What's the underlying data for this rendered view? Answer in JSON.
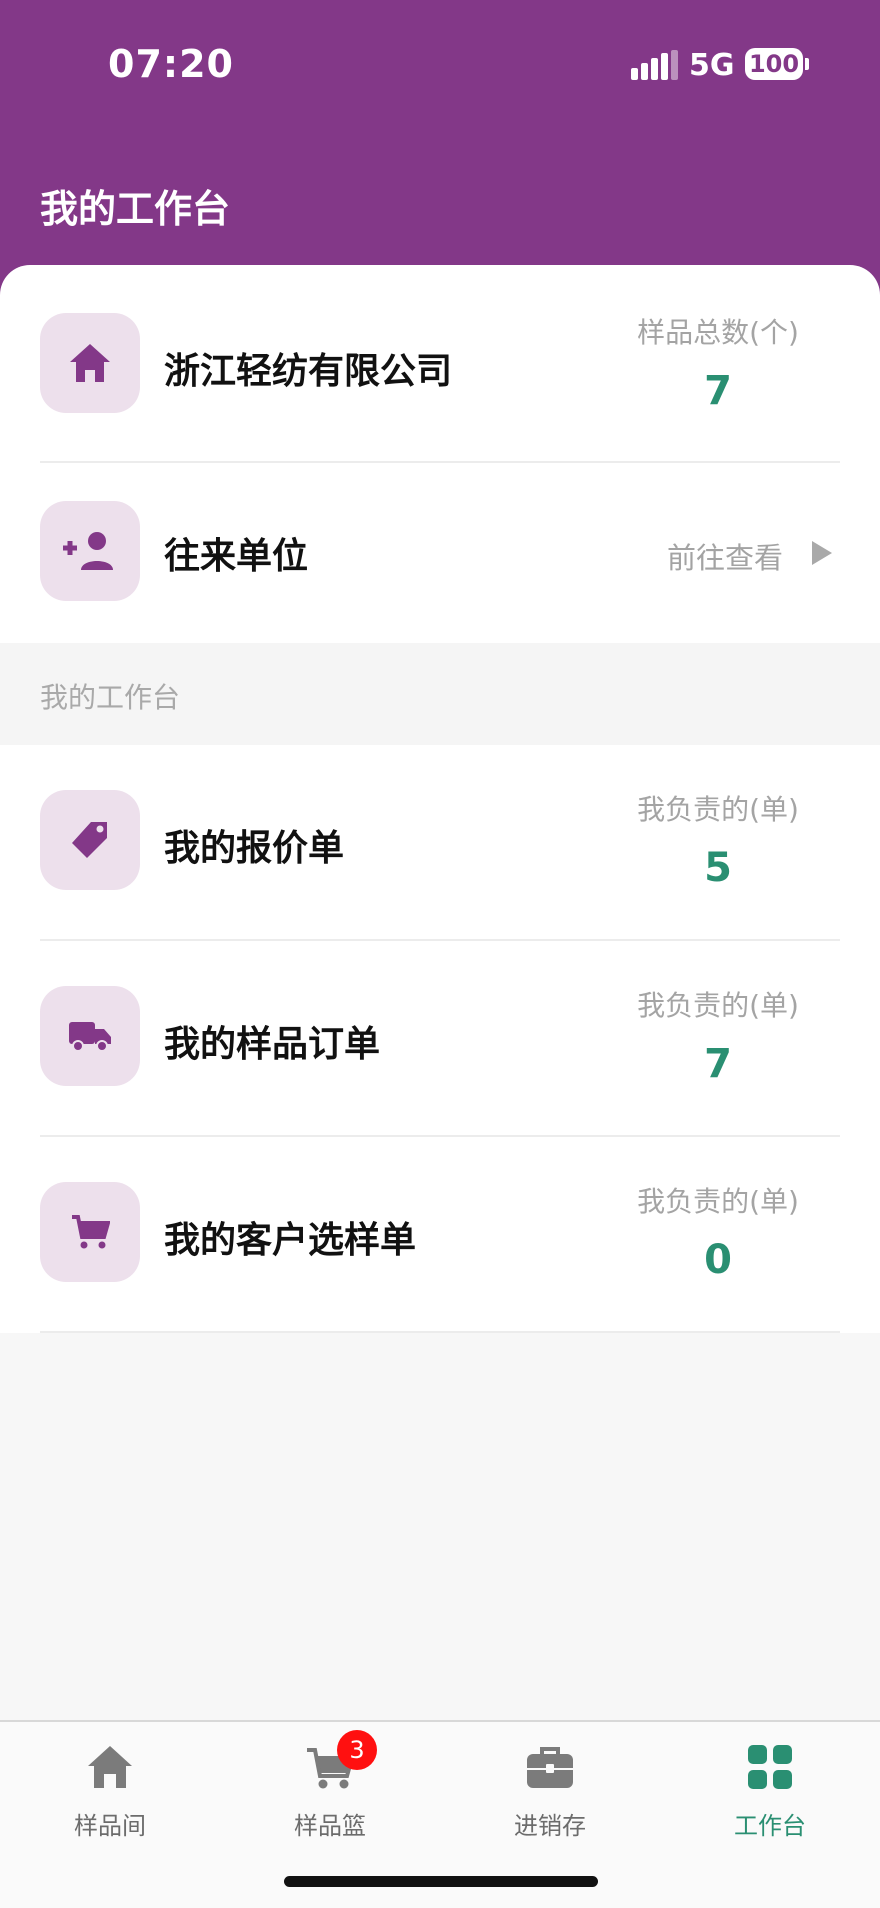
{
  "status_bar": {
    "time": "07:20",
    "network": "5G",
    "battery": "100"
  },
  "header": {
    "title": "我的工作台"
  },
  "company": {
    "name": "浙江轻纺有限公司",
    "stat_label": "样品总数(个)",
    "stat_value": "7",
    "icon": "home-icon"
  },
  "partners": {
    "title": "往来单位",
    "link_label": "前往查看",
    "icon": "add-person-icon"
  },
  "section": {
    "label": "我的工作台"
  },
  "work_items": [
    {
      "title": "我的报价单",
      "stat_label": "我负责的(单)",
      "stat_value": "5",
      "icon": "tag-icon"
    },
    {
      "title": "我的样品订单",
      "stat_label": "我负责的(单)",
      "stat_value": "7",
      "icon": "truck-icon"
    },
    {
      "title": "我的客户选样单",
      "stat_label": "我负责的(单)",
      "stat_value": "0",
      "icon": "cart-icon"
    }
  ],
  "tabbar": {
    "tabs": [
      {
        "label": "样品间",
        "icon": "home-icon"
      },
      {
        "label": "样品篮",
        "icon": "cart-icon",
        "badge": "3"
      },
      {
        "label": "进销存",
        "icon": "briefcase-icon"
      },
      {
        "label": "工作台",
        "icon": "grid-icon",
        "active": true
      }
    ]
  },
  "colors": {
    "brand": "#833888",
    "accent": "#2a8f72",
    "icon_bg": "#ede0ec",
    "badge": "#ff1010"
  }
}
